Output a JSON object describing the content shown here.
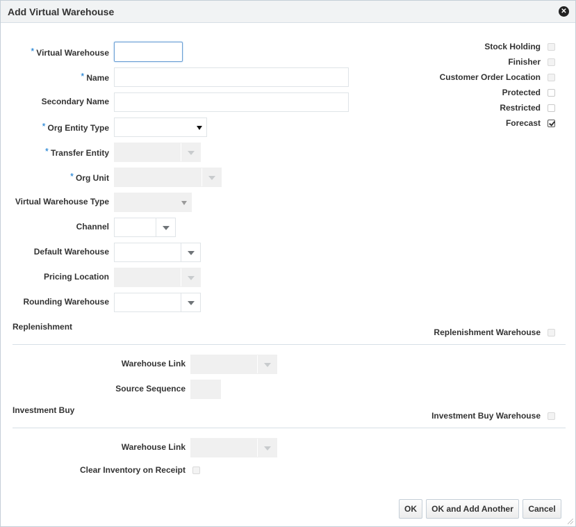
{
  "dialog": {
    "title": "Add Virtual Warehouse",
    "close_icon": "close-circle-icon",
    "required_marker": "*"
  },
  "fields": {
    "virtual_warehouse": {
      "label": "Virtual Warehouse",
      "value": ""
    },
    "name": {
      "label": "Name",
      "value": ""
    },
    "secondary_name": {
      "label": "Secondary Name",
      "value": ""
    },
    "org_entity_type": {
      "label": "Org Entity Type",
      "value": ""
    },
    "transfer_entity": {
      "label": "Transfer Entity",
      "value": ""
    },
    "org_unit": {
      "label": "Org Unit",
      "value": ""
    },
    "virtual_warehouse_type": {
      "label": "Virtual Warehouse Type",
      "value": ""
    },
    "channel": {
      "label": "Channel",
      "value": ""
    },
    "default_warehouse": {
      "label": "Default Warehouse",
      "value": ""
    },
    "pricing_location": {
      "label": "Pricing Location",
      "value": ""
    },
    "rounding_warehouse": {
      "label": "Rounding Warehouse",
      "value": ""
    }
  },
  "checkboxes": {
    "stock_holding": {
      "label": "Stock Holding",
      "checked": false
    },
    "finisher": {
      "label": "Finisher",
      "checked": false
    },
    "customer_order_location": {
      "label": "Customer Order Location",
      "checked": false
    },
    "protected": {
      "label": "Protected",
      "checked": false
    },
    "restricted": {
      "label": "Restricted",
      "checked": false
    },
    "forecast": {
      "label": "Forecast",
      "checked": true
    }
  },
  "replenishment": {
    "section_title": "Replenishment",
    "warehouse_checkbox_label": "Replenishment Warehouse",
    "warehouse_link_label": "Warehouse Link",
    "source_sequence_label": "Source Sequence"
  },
  "investment_buy": {
    "section_title": "Investment Buy",
    "warehouse_checkbox_label": "Investment Buy Warehouse",
    "warehouse_link_label": "Warehouse Link",
    "clear_inventory_label": "Clear Inventory on Receipt"
  },
  "buttons": {
    "ok": "OK",
    "ok_add_another": "OK and Add Another",
    "cancel": "Cancel"
  },
  "colors": {
    "required": "#0572ce",
    "titlebar_bg": "#f1f3f4",
    "border": "#c4ced7"
  }
}
